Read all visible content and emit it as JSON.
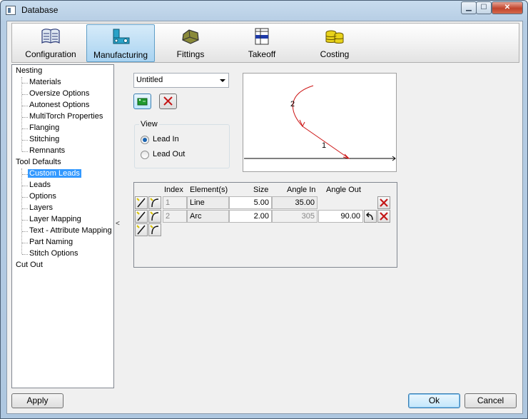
{
  "window": {
    "title": "Database"
  },
  "ribbon": {
    "tabs": [
      {
        "label": "Configuration",
        "icon": "configuration-icon"
      },
      {
        "label": "Manufacturing",
        "icon": "manufacturing-icon",
        "active": true
      },
      {
        "label": "Fittings",
        "icon": "fittings-icon"
      },
      {
        "label": "Takeoff",
        "icon": "takeoff-icon"
      },
      {
        "label": "Costing",
        "icon": "costing-icon"
      }
    ]
  },
  "tree": {
    "items": [
      {
        "label": "Nesting",
        "level": 0
      },
      {
        "label": "Materials",
        "level": 1
      },
      {
        "label": "Oversize Options",
        "level": 1
      },
      {
        "label": "Autonest Options",
        "level": 1
      },
      {
        "label": "MultiTorch Properties",
        "level": 1
      },
      {
        "label": "Flanging",
        "level": 1
      },
      {
        "label": "Stitching",
        "level": 1
      },
      {
        "label": "Remnants",
        "level": 1
      },
      {
        "label": "Tool Defaults",
        "level": 0
      },
      {
        "label": "Custom Leads",
        "level": 1,
        "selected": true
      },
      {
        "label": "Leads",
        "level": 1
      },
      {
        "label": "Options",
        "level": 1
      },
      {
        "label": "Layers",
        "level": 1
      },
      {
        "label": "Layer Mapping",
        "level": 1
      },
      {
        "label": "Text - Attribute Mapping",
        "level": 1
      },
      {
        "label": "Part Naming",
        "level": 1
      },
      {
        "label": "Stitch Options",
        "level": 1
      },
      {
        "label": "Cut Out",
        "level": 0
      }
    ]
  },
  "splitter": {
    "glyph": "<"
  },
  "lead_selector": {
    "value": "Untitled"
  },
  "view": {
    "legend": "View",
    "options": [
      {
        "label": "Lead In",
        "checked": true
      },
      {
        "label": "Lead Out",
        "checked": false
      }
    ]
  },
  "preview": {
    "labels": [
      "2",
      "1"
    ],
    "stroke_color": "#cc1111"
  },
  "elements_table": {
    "headers": [
      "Index",
      "Element(s)",
      "Size",
      "Angle In",
      "Angle Out"
    ],
    "rows": [
      {
        "index": "1",
        "element": "Line",
        "size": "5.00",
        "angle_in": "35.00",
        "angle_out": ""
      },
      {
        "index": "2",
        "element": "Arc",
        "size": "2.00",
        "angle_in": "305",
        "angle_out": "90.00"
      }
    ]
  },
  "buttons": {
    "apply": "Apply",
    "ok": "Ok",
    "cancel": "Cancel"
  },
  "colors": {
    "accent": "#3399ff",
    "delete_red": "#cc1a1a"
  }
}
